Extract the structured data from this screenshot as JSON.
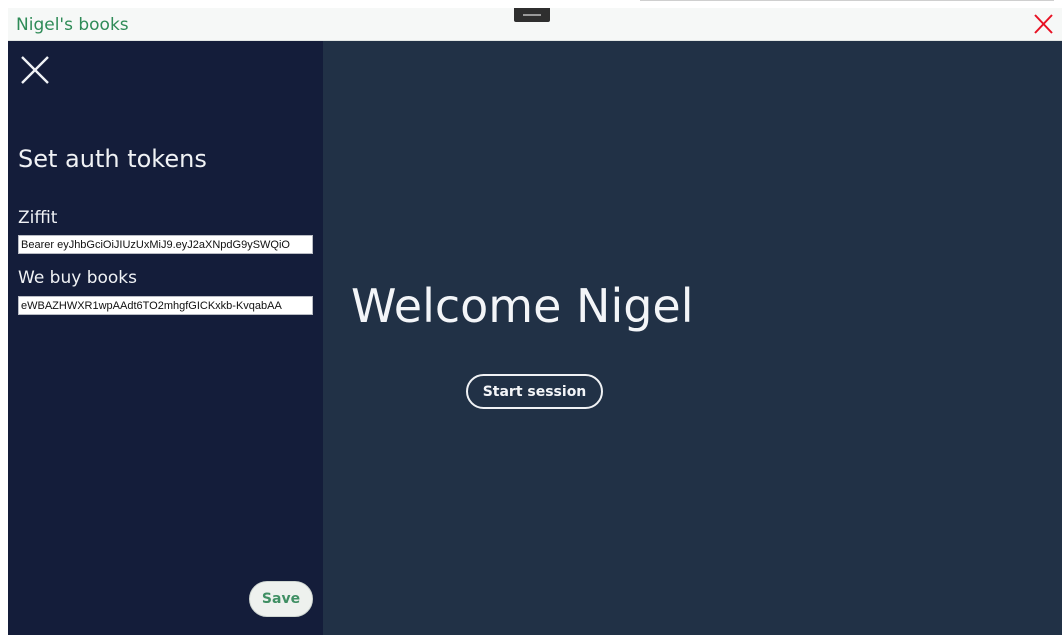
{
  "window": {
    "title": "Nigel's books",
    "close_icon": "close-icon",
    "close_color": "#e81123"
  },
  "sidebar": {
    "close_icon": "close-icon",
    "heading": "Set auth tokens",
    "fields": [
      {
        "label": "Ziffit",
        "value": "Bearer eyJhbGciOiJIUzUxMiJ9.eyJ2aXNpdG9ySWQiO"
      },
      {
        "label": "We buy books",
        "value": "eWBAZHWXR1wpAAdt6TO2mhgfGICKxkb-KvqabAA"
      }
    ],
    "save_label": "Save"
  },
  "main": {
    "welcome": "Welcome Nigel",
    "start_label": "Start session"
  },
  "colors": {
    "sidebar_bg": "#141d3a",
    "main_bg": "#213146",
    "title_accent": "#2e8b57"
  }
}
